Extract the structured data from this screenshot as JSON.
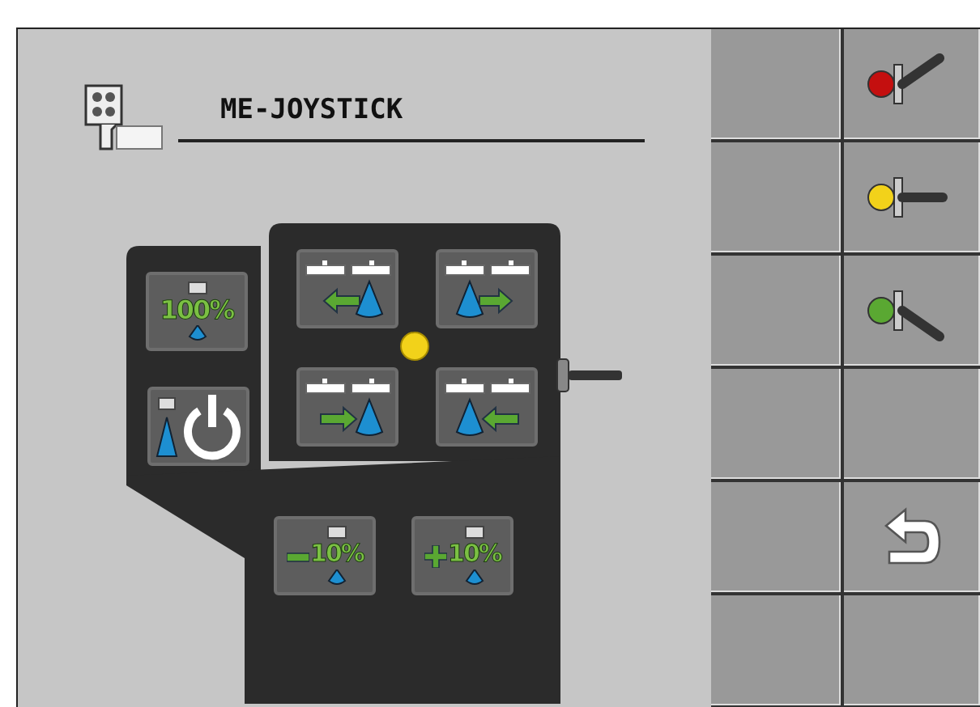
{
  "header": {
    "title": "ME-JOYSTICK"
  },
  "joystick": {
    "side_buttons": [
      {
        "kind": "percent",
        "label": "100%"
      },
      {
        "kind": "power"
      }
    ],
    "grid_buttons": [
      {
        "kind": "shift-left-drop-right"
      },
      {
        "kind": "shift-right-drop-left"
      },
      {
        "kind": "shift-right-drop-right"
      },
      {
        "kind": "shift-left-drop-left"
      }
    ],
    "bottom_buttons": [
      {
        "kind": "minus",
        "label": "10%"
      },
      {
        "kind": "plus",
        "label": "10%"
      }
    ]
  },
  "softkeys": [
    {
      "kind": "lever-up",
      "color": "#c40f0f"
    },
    {
      "kind": "lever-level",
      "color": "#f2d21a"
    },
    {
      "kind": "lever-down",
      "color": "#5aa832"
    },
    {
      "kind": "empty"
    },
    {
      "kind": "back"
    },
    {
      "kind": "empty"
    }
  ]
}
